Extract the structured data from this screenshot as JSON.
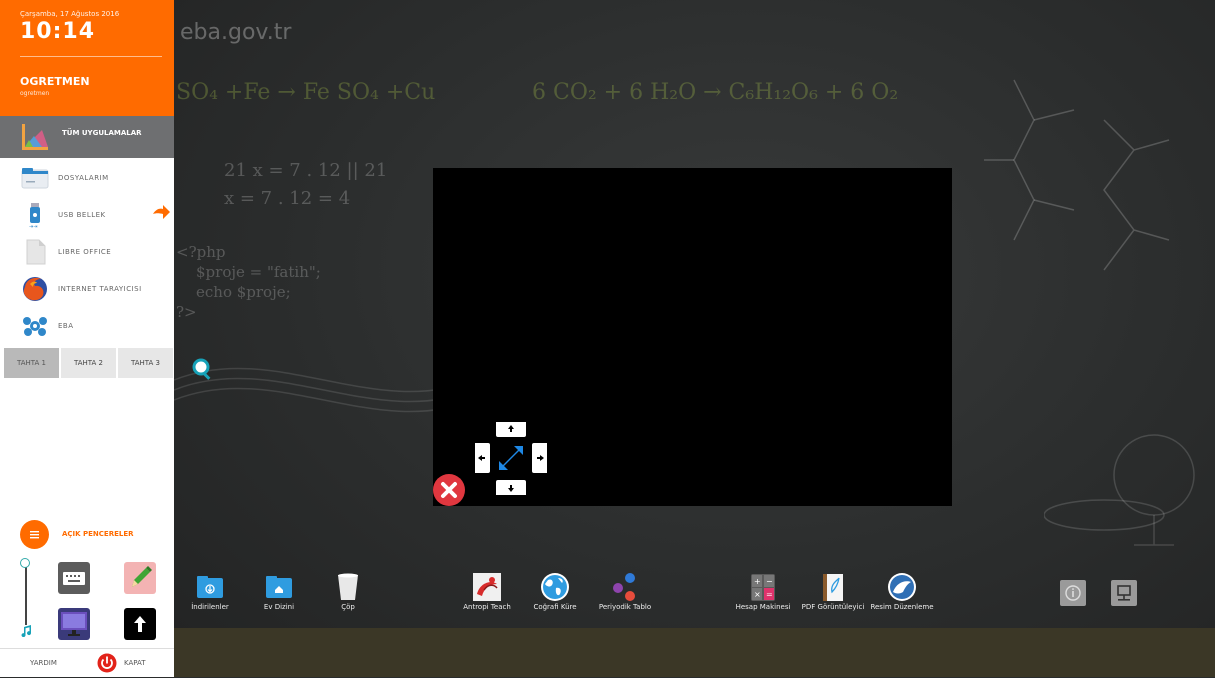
{
  "sidebar": {
    "date": "Çarşamba, 17 Ağustos 2016",
    "time": "10:14",
    "user_name": "OGRETMEN",
    "user_sub": "ogretmen",
    "all_apps_label": "TÜM UYGULAMALAR",
    "apps": [
      {
        "label": "DOSYALARIM",
        "icon": "folder-icon"
      },
      {
        "label": "USB BELLEK",
        "icon": "usb-icon"
      },
      {
        "label": "LIBRE OFFICE",
        "icon": "document-icon"
      },
      {
        "label": "INTERNET TARAYICISI",
        "icon": "firefox-icon"
      },
      {
        "label": "EBA",
        "icon": "eba-icon"
      }
    ],
    "board_tabs": [
      "TAHTA 1",
      "TAHTA 2",
      "TAHTA 3"
    ],
    "active_board": "TAHTA 1",
    "open_windows_label": "AÇIK PENCERELER",
    "help_label": "YARDIM",
    "shutdown_label": "KAPAT"
  },
  "desktop": {
    "background_text": {
      "url": "eba.gov.tr",
      "eq1": "SO₄ +Fe → Fe SO₄ +Cu",
      "eq2": "6 CO₂ + 6 H₂O → C₆H₁₂O₆ + 6 O₂",
      "math1": "21 x = 7 . 12 || 21",
      "math2": "x = 7 . 12 = 4",
      "php1": "<?php",
      "php2": "$proje = \"fatih\";",
      "php3": "echo $proje;",
      "php4": "?>"
    },
    "dock": [
      {
        "label": "İndirilenler",
        "icon": "downloads-folder-icon"
      },
      {
        "label": "Ev Dizini",
        "icon": "home-folder-icon"
      },
      {
        "label": "Çöp",
        "icon": "trash-icon"
      },
      {
        "label": "Antropi Teach",
        "icon": "antropi-teach-icon"
      },
      {
        "label": "Coğrafi Küre",
        "icon": "globe-icon"
      },
      {
        "label": "Periyodik Tablo",
        "icon": "periodic-table-icon"
      },
      {
        "label": "Hesap Makinesi",
        "icon": "calculator-icon"
      },
      {
        "label": "PDF Görüntüleyici",
        "icon": "pdf-viewer-icon"
      },
      {
        "label": "Resim Düzenleme",
        "icon": "image-editor-icon"
      }
    ]
  },
  "colors": {
    "accent": "#ff6b00",
    "sidebar_bg": "#ffffff",
    "all_apps_bg": "#6e6f71",
    "close_red": "#e0373f",
    "control_blue": "#1e88e5"
  }
}
